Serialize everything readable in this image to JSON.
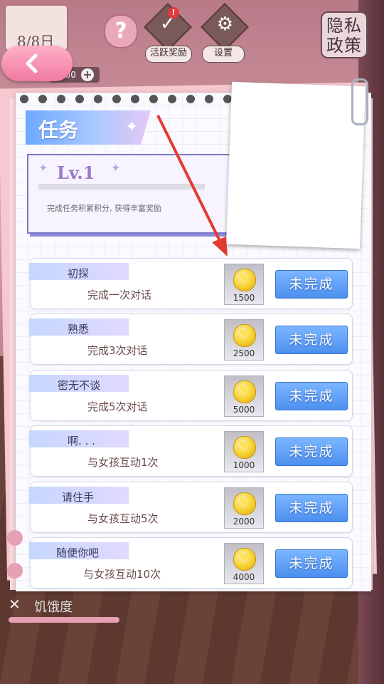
{
  "header": {
    "date": "8/8日",
    "coins_display": "000",
    "activity_label": "活跃奖励",
    "settings_label": "设置",
    "privacy_line1": "隐私",
    "privacy_line2": "政策",
    "notification_mark": "!"
  },
  "panel": {
    "title": "任务",
    "level": "Lv.1",
    "level_desc": "完成任务积累积分, 获得丰富奖励"
  },
  "tasks": [
    {
      "name": "初探",
      "desc": "完成一次对话",
      "reward": "1500",
      "status": "未完成"
    },
    {
      "name": "熟悉",
      "desc": "完成3次对话",
      "reward": "2500",
      "status": "未完成"
    },
    {
      "name": "密无不谈",
      "desc": "完成5次对话",
      "reward": "5000",
      "status": "未完成"
    },
    {
      "name": "啊. . .",
      "desc": "与女孩互动1次",
      "reward": "1000",
      "status": "未完成"
    },
    {
      "name": "请住手",
      "desc": "与女孩互动5次",
      "reward": "2000",
      "status": "未完成"
    },
    {
      "name": "随便你吧",
      "desc": "与女孩互动10次",
      "reward": "4000",
      "status": "未完成"
    }
  ],
  "footer": {
    "stat_label": "饥饿度"
  },
  "colors": {
    "accent_blue": "#4d8ff0",
    "pink": "#f07aa0",
    "arrow_red": "#e23a2e"
  }
}
